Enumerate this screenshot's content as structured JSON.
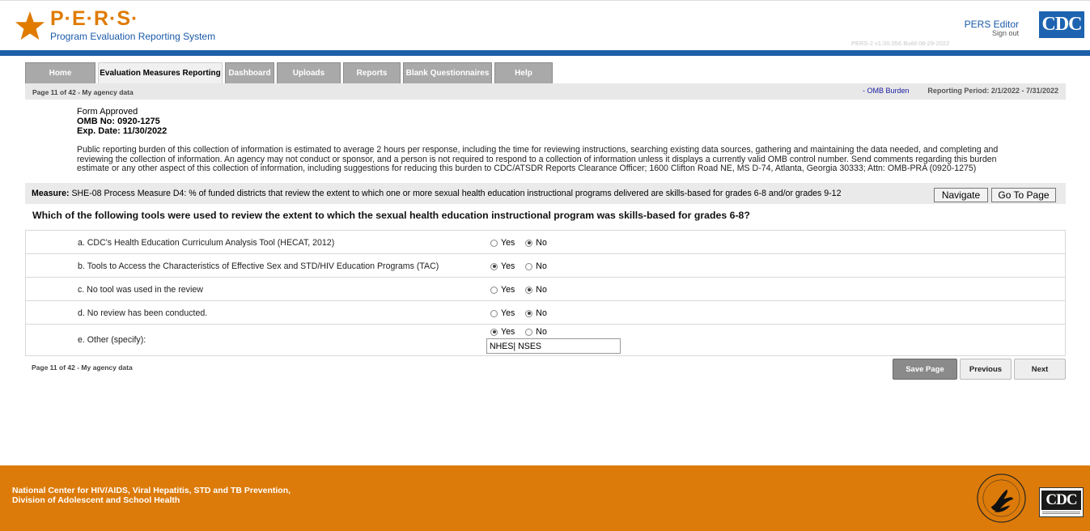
{
  "header": {
    "logo_title": "P·E·R·S·",
    "logo_subtitle": "Program Evaluation Reporting System",
    "editor_label": "PERS Editor",
    "signout_label": "Sign out",
    "version": "PERS-2 v1.00.056    Build 08-29-2022",
    "cdc_logo_text": "CDC",
    "accent_color": "#e07b00",
    "brand_blue": "#1d5fa8"
  },
  "tabs": [
    {
      "label": "Home",
      "active": false
    },
    {
      "label": "Evaluation Measures Reporting",
      "active": true
    },
    {
      "label": "Dashboard",
      "active": false
    },
    {
      "label": "Uploads",
      "active": false
    },
    {
      "label": "Reports",
      "active": false
    },
    {
      "label": "Blank Questionnaires",
      "active": false
    },
    {
      "label": "Help",
      "active": false
    }
  ],
  "subbar": {
    "page_info": "Page 11 of 42 - My agency data",
    "omb_link": "- OMB Burden",
    "reporting_period": "Reporting Period: 2/1/2022 - 7/31/2022"
  },
  "form": {
    "approved": "Form Approved",
    "omb_no": "OMB No: 0920-1275",
    "exp_date": "Exp. Date: 11/30/2022",
    "burden_statement": "Public reporting burden of this collection of information is estimated to average 2 hours per response, including the time for reviewing instructions, searching existing data sources, gathering and maintaining the data needed, and completing and reviewing the collection of information. An agency may not conduct or sponsor, and a person is not required to respond to a collection of information unless it displays a currently valid OMB control number. Send comments regarding this burden estimate or any other aspect of this collection of information, including suggestions for reducing this burden to CDC/ATSDR Reports Clearance Officer; 1600 Clifton Road NE, MS D-74, Atlanta, Georgia 30333; Attn: OMB-PRA (0920-1275)"
  },
  "measure": {
    "label": "Measure:",
    "text": "SHE-08 Process Measure D4: % of funded districts that review the extent to which one or more sexual health education instructional programs delivered are skills-based for grades 6-8 and/or grades 9-12",
    "navigate_label": "Navigate",
    "goto_label": "Go To Page"
  },
  "question": "Which of the following tools were used to review the extent to which the sexual health education instructional program was skills-based for grades 6-8?",
  "items": [
    {
      "label": "a. CDC's Health Education Curriculum Analysis Tool (HECAT, 2012)",
      "yes": "Yes",
      "no": "No",
      "selected": "no"
    },
    {
      "label": "b. Tools to Access the Characteristics of Effective Sex and STD/HIV Education Programs (TAC)",
      "yes": "Yes",
      "no": "No",
      "selected": "yes"
    },
    {
      "label": "c. No tool was used in the review",
      "yes": "Yes",
      "no": "No",
      "selected": "no"
    },
    {
      "label": "d. No review has been conducted.",
      "yes": "Yes",
      "no": "No",
      "selected": "no"
    },
    {
      "label": "e. Other (specify):",
      "yes": "Yes",
      "no": "No",
      "selected": "yes",
      "specify_value": "NHES| NSES"
    }
  ],
  "bottom": {
    "page_info": "Page 11 of 42 - My agency data",
    "save_label": "Save Page",
    "previous_label": "Previous",
    "next_label": "Next"
  },
  "footer": {
    "line1": "National Center for HIV/AIDS, Viral Hepatitis, STD and TB Prevention,",
    "line2": "Division of Adolescent and School Health",
    "cdc_logo_text": "CDC",
    "footer_color": "#dc7b0a"
  }
}
